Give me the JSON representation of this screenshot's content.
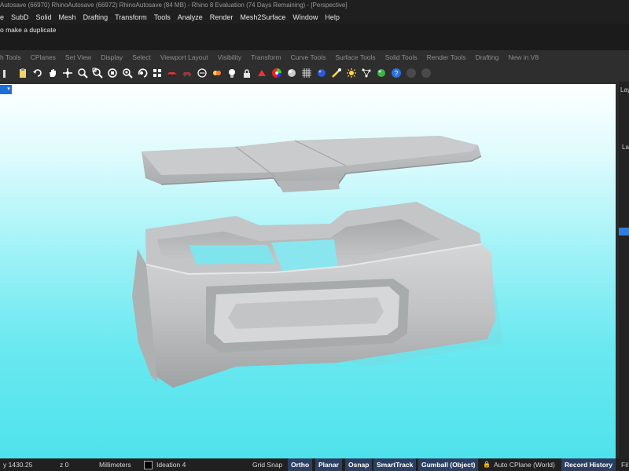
{
  "titlebar": {
    "text": "Autosave (66970) RhinoAutosave (66972) RhinoAutosave (84 MB) - Rhino 8 Evaluation (74 Days Remaining) - [Perspective]"
  },
  "menu": [
    "SubD",
    "Solid",
    "Mesh",
    "Drafting",
    "Transform",
    "Tools",
    "Analyze",
    "Render",
    "Mesh2Surface",
    "Window",
    "Help"
  ],
  "menu_first": "e",
  "command": {
    "prompt": "o make a duplicate"
  },
  "tabs": [
    "h Tools",
    "CPlanes",
    "Set View",
    "Display",
    "Select",
    "Viewport Layout",
    "Visibility",
    "Transform",
    "Curve Tools",
    "Surface Tools",
    "Solid Tools",
    "Render Tools",
    "Drafting",
    "New in V8"
  ],
  "toolbar_icons": [
    "new-file-icon",
    "undo-icon",
    "pan-hand-icon",
    "move-view-icon",
    "zoom-icon",
    "zoom-window-icon",
    "zoom-extents-icon",
    "zoom-selected-icon",
    "rotate-view-icon",
    "shaded-car-icon",
    "rendered-car-icon",
    "grid-icon",
    "lightbulb-icon",
    "lock-icon",
    "material-icon",
    "color-wheel-icon",
    "sphere-icon",
    "grid-snap-icon",
    "blue-sphere-icon",
    "render-icon",
    "sun-icon",
    "network-icon",
    "green-sphere-icon",
    "help-icon",
    "round-button-icon"
  ],
  "viewport": {
    "name": "Perspective"
  },
  "right_panel": {
    "label": "Lay",
    "label2": "Lay"
  },
  "status": {
    "y": "y 1430.25",
    "z": "z 0",
    "units": "Millimeters",
    "layer": "Ideation 4",
    "grid_snap": "Grid Snap",
    "ortho": "Ortho",
    "planar": "Planar",
    "osnap": "Osnap",
    "smarttrack": "SmartTrack",
    "gumball": "Gumball (Object)",
    "cplane": "Auto CPlane (World)",
    "record_history": "Record History",
    "filter": "Fil"
  },
  "colors": {
    "accent": "#2f7ee0",
    "viewport_top": "#ffffff",
    "viewport_bottom": "#4fe2ec",
    "model": "#b9bcbd"
  }
}
